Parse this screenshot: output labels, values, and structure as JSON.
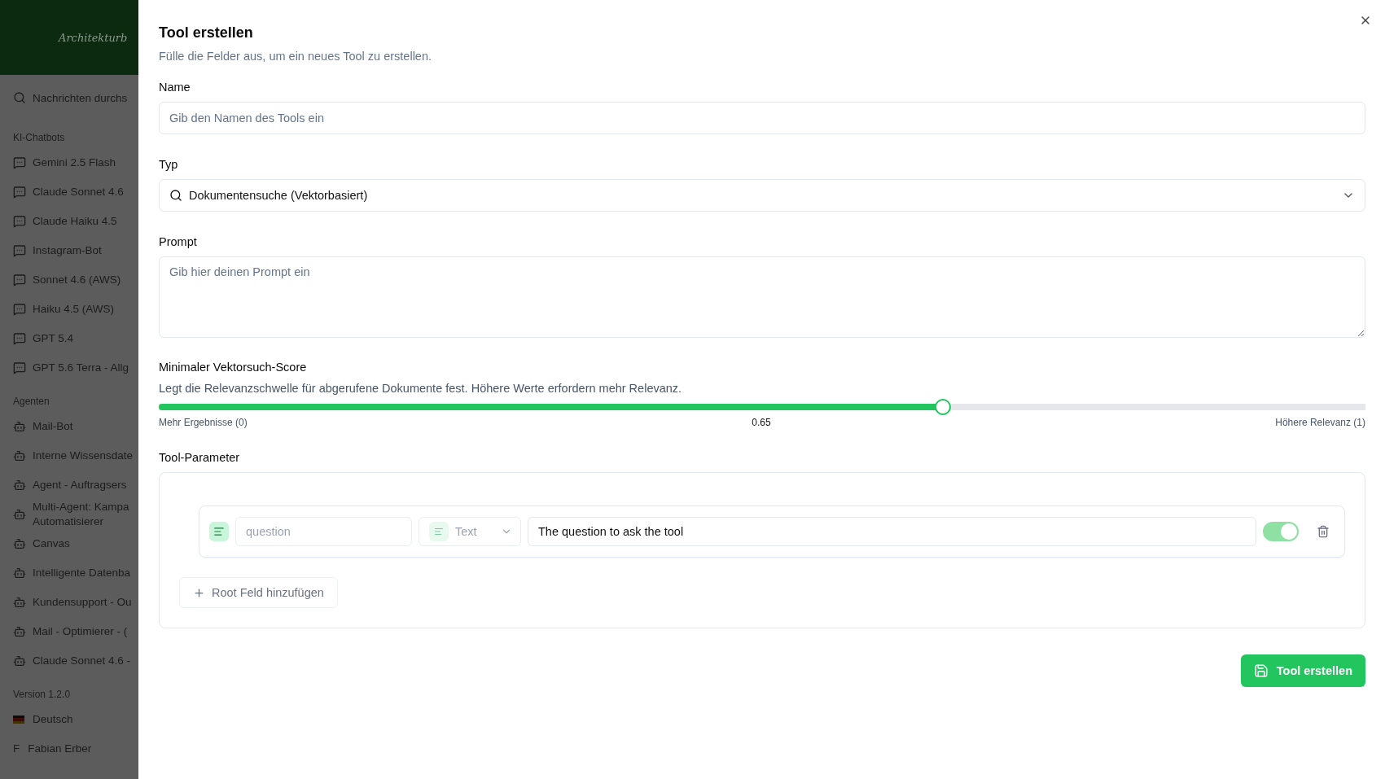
{
  "sidebar": {
    "logo": "Architekturb",
    "search": {
      "placeholder": "Nachrichten durchs"
    },
    "sections": [
      {
        "title": "KI-Chatbots",
        "kind": "chat",
        "items": [
          "Gemini 2.5 Flash",
          "Claude Sonnet 4.6",
          "Claude Haiku 4.5",
          "Instagram-Bot",
          "Sonnet 4.6 (AWS)",
          "Haiku 4.5 (AWS)",
          "GPT 5.4",
          "GPT 5.6 Terra - Allg"
        ]
      },
      {
        "title": "Agenten",
        "kind": "agent",
        "items": [
          "Mail-Bot",
          "Interne Wissensdate",
          "Agent - Auftragsers",
          "Multi-Agent: Kampa\nAutomatisierer",
          "Canvas",
          "Intelligente Datenba",
          "Kundensupport - Ou",
          "Mail - Optimierer - (",
          "Claude Sonnet 4.6 -"
        ]
      }
    ],
    "version": "Version 1.2.0",
    "language": "Deutsch",
    "user": {
      "initial": "F",
      "name": "Fabian Erber"
    }
  },
  "dialog": {
    "title": "Tool erstellen",
    "description": "Fülle die Felder aus, um ein neues Tool zu erstellen.",
    "name": {
      "label": "Name",
      "placeholder": "Gib den Namen des Tools ein"
    },
    "type": {
      "label": "Typ",
      "value": "Dokumentensuche (Vektorbasiert)"
    },
    "prompt": {
      "label": "Prompt",
      "placeholder": "Gib hier deinen Prompt ein"
    },
    "score": {
      "label": "Minimaler Vektorsuch-Score",
      "description": "Legt die Relevanzschwelle für abgerufene Dokumente fest. Höhere Werte erfordern mehr Relevanz.",
      "level": 0.65,
      "min_label": "Mehr Ergebnisse (0)",
      "reading": "0.65",
      "max_label": "Höhere Relevanz (1)"
    },
    "parameters": {
      "label": "Tool-Parameter",
      "rows": [
        {
          "name_placeholder": "question",
          "type": "Text",
          "description": "The question to ask the tool",
          "on": true
        }
      ],
      "add_button": "Root Feld hinzufügen"
    },
    "submit": "Tool erstellen"
  }
}
